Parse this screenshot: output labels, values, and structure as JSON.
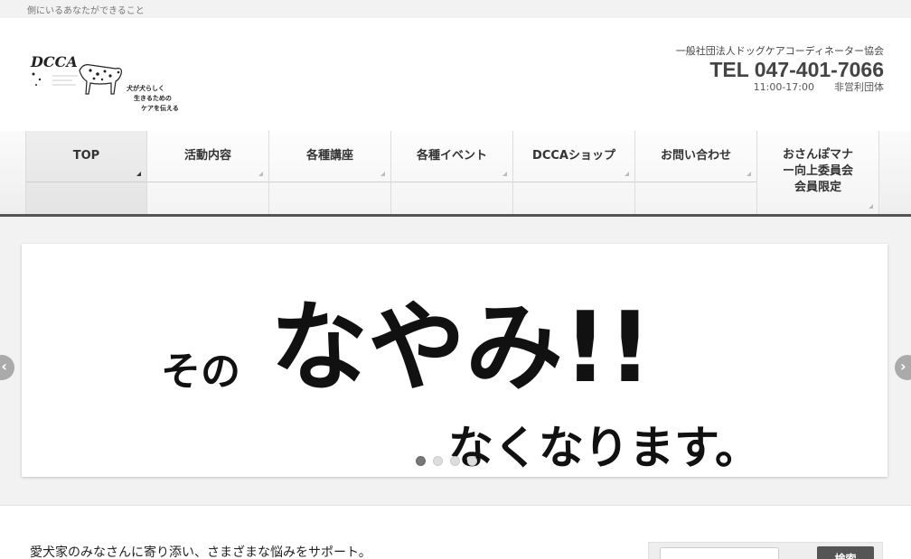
{
  "topbar": {
    "tagline": "側にいるあなたができること"
  },
  "header": {
    "logo": {
      "brand": "DCCA",
      "slogan_lines": [
        "犬が犬らしく",
        "生きるための",
        "ケアを伝える"
      ]
    },
    "org_name": "一般社団法人ドッグケアコーディネーター協会",
    "tel": "TEL 047-401-7066",
    "hours": "11:00-17:00",
    "org_type": "非営利団体"
  },
  "nav": {
    "items": [
      {
        "label": "TOP"
      },
      {
        "label": "活動内容"
      },
      {
        "label": "各種講座"
      },
      {
        "label": "各種イベント"
      },
      {
        "label": "DCCAショップ"
      },
      {
        "label": "お問い合わせ"
      },
      {
        "label": "おさんぽマナー向上委員会会員限定"
      }
    ]
  },
  "slider": {
    "slide_text": {
      "small": "その",
      "big": "なやみ!!",
      "sub": "なくなります。"
    },
    "prev_label": "‹",
    "next_label": "›"
  },
  "content": {
    "intro": "愛犬家のみなさんに寄り添い、さまざまな悩みをサポート。",
    "search_button": "検索"
  }
}
